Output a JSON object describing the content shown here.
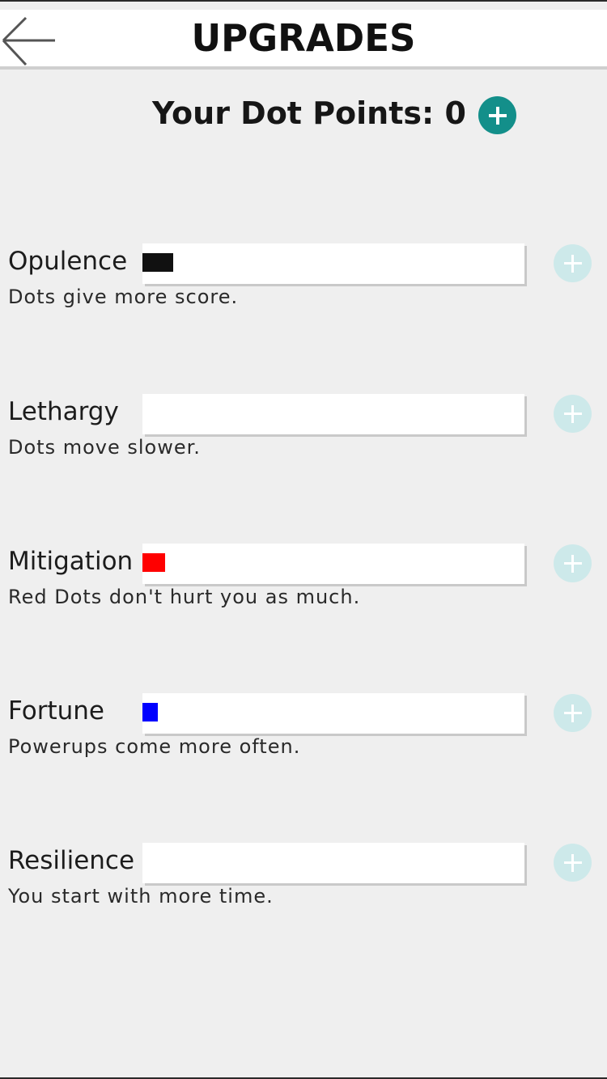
{
  "header": {
    "title": "UPGRADES",
    "back_icon": "arrow-left-icon"
  },
  "points": {
    "label": "Your Dot Points: 0",
    "value": 0,
    "add_icon": "plus-circle-icon",
    "add_color": "#138f8a"
  },
  "upgrades": [
    {
      "name": "Opulence",
      "description": "Dots give more score.",
      "level_fraction": 0.08,
      "fill_color": "#111111"
    },
    {
      "name": "Lethargy",
      "description": "Dots move slower.",
      "level_fraction": 0.0,
      "fill_color": "#111111"
    },
    {
      "name": "Mitigation",
      "description": "Red Dots don't hurt you as much.",
      "level_fraction": 0.06,
      "fill_color": "#ff0000"
    },
    {
      "name": "Fortune",
      "description": "Powerups come more often.",
      "level_fraction": 0.04,
      "fill_color": "#0000ff"
    },
    {
      "name": "Resilience",
      "description": "You start with more time.",
      "level_fraction": 0.0,
      "fill_color": "#111111"
    }
  ],
  "colors": {
    "background": "#efefef",
    "disabled_add": "#cde9ea"
  }
}
